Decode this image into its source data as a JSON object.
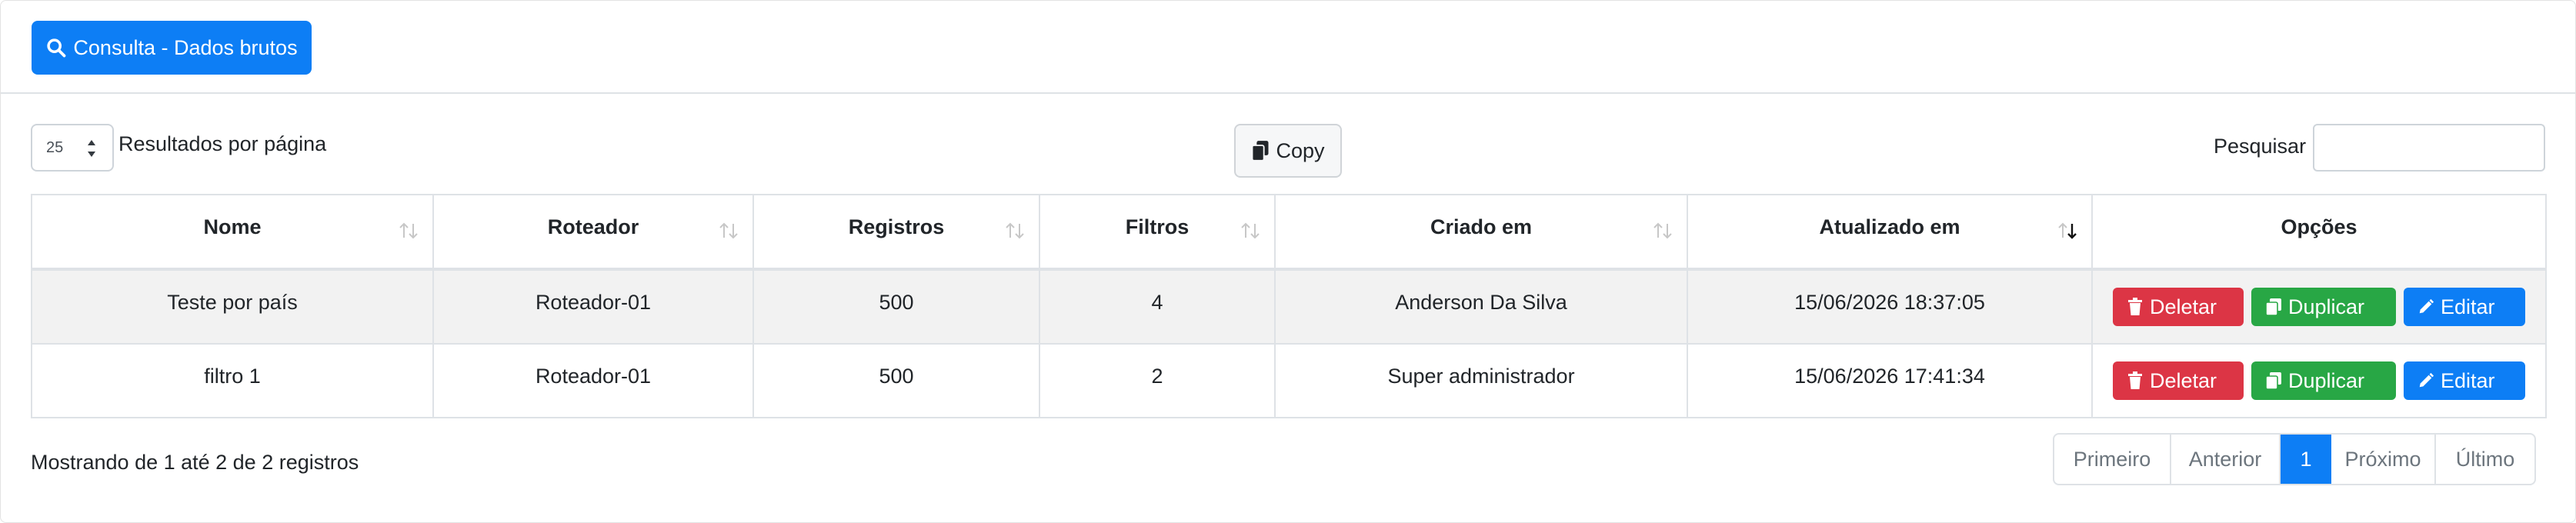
{
  "header": {
    "query_button_label": "Consulta - Dados brutos"
  },
  "controls": {
    "page_length_value": "25",
    "page_length_label": "Resultados por página",
    "copy_label": "Copy",
    "search_label": "Pesquisar",
    "search_value": ""
  },
  "table": {
    "columns": [
      "Nome",
      "Roteador",
      "Registros",
      "Filtros",
      "Criado em",
      "Atualizado em",
      "Opções"
    ],
    "rows": [
      {
        "nome": "Teste por país",
        "roteador": "Roteador-01",
        "registros": "500",
        "filtros": "4",
        "criado_em": "Anderson Da Silva",
        "atualizado_em": "15/06/2026 18:37:05"
      },
      {
        "nome": "filtro 1",
        "roteador": "Roteador-01",
        "registros": "500",
        "filtros": "2",
        "criado_em": "Super administrador",
        "atualizado_em": "15/06/2026 17:41:34"
      }
    ],
    "actions": {
      "delete_label": "Deletar",
      "duplicate_label": "Duplicar",
      "edit_label": "Editar"
    }
  },
  "footer": {
    "info_text": "Mostrando de 1 até 2 de 2 registros",
    "pagination": {
      "first": "Primeiro",
      "previous": "Anterior",
      "current": "1",
      "next": "Próximo",
      "last": "Último"
    }
  },
  "colors": {
    "primary": "#0d7ef5",
    "danger": "#dc3545",
    "success": "#28a745"
  },
  "icons": {
    "query_button": "search-icon",
    "copy": "copy-icon",
    "delete": "trash-icon",
    "duplicate": "duplicate-icon",
    "edit": "pencil-icon"
  }
}
